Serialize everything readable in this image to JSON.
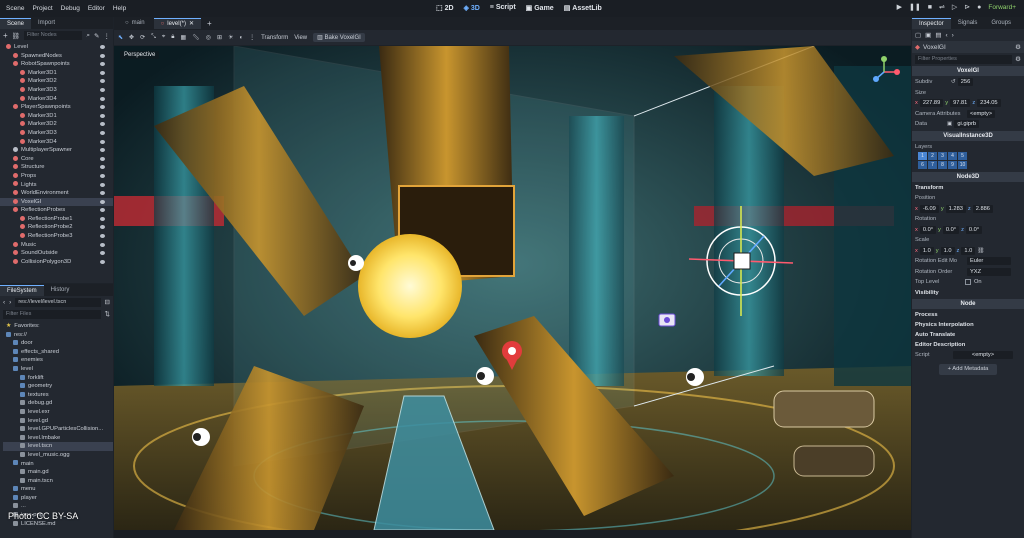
{
  "menu": [
    "Scene",
    "Project",
    "Debug",
    "Editor",
    "Help"
  ],
  "workspaces": [
    "2D",
    "3D",
    "Script",
    "Game",
    "AssetLib"
  ],
  "renderer": "Forward+",
  "scene_dock": {
    "tabs": [
      "Scene",
      "Import"
    ],
    "filter_placeholder": "Filter Nodes",
    "nodes": [
      {
        "label": "Level",
        "depth": 0,
        "color": "#e06b6b"
      },
      {
        "label": "SpawnedNodes",
        "depth": 1,
        "color": "#e06b6b"
      },
      {
        "label": "RobotSpawnpoints",
        "depth": 1,
        "color": "#e06b6b"
      },
      {
        "label": "Marker3D1",
        "depth": 2,
        "color": "#e06b6b"
      },
      {
        "label": "Marker3D2",
        "depth": 2,
        "color": "#e06b6b"
      },
      {
        "label": "Marker3D3",
        "depth": 2,
        "color": "#e06b6b"
      },
      {
        "label": "Marker3D4",
        "depth": 2,
        "color": "#e06b6b"
      },
      {
        "label": "PlayerSpawnpoints",
        "depth": 1,
        "color": "#e06b6b"
      },
      {
        "label": "Marker3D1",
        "depth": 2,
        "color": "#e06b6b"
      },
      {
        "label": "Marker3D2",
        "depth": 2,
        "color": "#e06b6b"
      },
      {
        "label": "Marker3D3",
        "depth": 2,
        "color": "#e06b6b"
      },
      {
        "label": "Marker3D4",
        "depth": 2,
        "color": "#e06b6b"
      },
      {
        "label": "MultiplayerSpawner",
        "depth": 1,
        "color": "#b9bec7"
      },
      {
        "label": "Core",
        "depth": 1,
        "color": "#e06b6b"
      },
      {
        "label": "Structure",
        "depth": 1,
        "color": "#e06b6b"
      },
      {
        "label": "Props",
        "depth": 1,
        "color": "#e06b6b"
      },
      {
        "label": "Lights",
        "depth": 1,
        "color": "#e06b6b"
      },
      {
        "label": "WorldEnvironment",
        "depth": 1,
        "color": "#e06b6b"
      },
      {
        "label": "VoxelGI",
        "depth": 1,
        "color": "#e06b6b",
        "selected": true
      },
      {
        "label": "ReflectionProbes",
        "depth": 1,
        "color": "#e06b6b"
      },
      {
        "label": "ReflectionProbe1",
        "depth": 2,
        "color": "#e06b6b"
      },
      {
        "label": "ReflectionProbe2",
        "depth": 2,
        "color": "#e06b6b"
      },
      {
        "label": "ReflectionProbe3",
        "depth": 2,
        "color": "#e06b6b"
      },
      {
        "label": "Music",
        "depth": 1,
        "color": "#e06b6b"
      },
      {
        "label": "SoundOutside",
        "depth": 1,
        "color": "#e06b6b"
      },
      {
        "label": "CollisionPolygon3D",
        "depth": 1,
        "color": "#e06b6b"
      }
    ]
  },
  "fs_dock": {
    "tabs": [
      "FileSystem",
      "History"
    ],
    "path": "res://level/level.tscn",
    "filter_placeholder": "Filter Files",
    "items": [
      {
        "label": "Favorites:",
        "depth": 0,
        "kind": "star"
      },
      {
        "label": "res://",
        "depth": 0,
        "kind": "folder"
      },
      {
        "label": "door",
        "depth": 1,
        "kind": "folder"
      },
      {
        "label": "effects_shared",
        "depth": 1,
        "kind": "folder"
      },
      {
        "label": "enemies",
        "depth": 1,
        "kind": "folder"
      },
      {
        "label": "level",
        "depth": 1,
        "kind": "folder"
      },
      {
        "label": "forklift",
        "depth": 2,
        "kind": "folder"
      },
      {
        "label": "geometry",
        "depth": 2,
        "kind": "folder"
      },
      {
        "label": "textures",
        "depth": 2,
        "kind": "folder"
      },
      {
        "label": "debug.gd",
        "depth": 2,
        "kind": "file"
      },
      {
        "label": "level.exr",
        "depth": 2,
        "kind": "file"
      },
      {
        "label": "level.gd",
        "depth": 2,
        "kind": "file"
      },
      {
        "label": "level.GPUParticlesCollision...",
        "depth": 2,
        "kind": "file"
      },
      {
        "label": "level.lmbake",
        "depth": 2,
        "kind": "file"
      },
      {
        "label": "level.tscn",
        "depth": 2,
        "kind": "file",
        "selected": true
      },
      {
        "label": "level_music.ogg",
        "depth": 2,
        "kind": "file"
      },
      {
        "label": "main",
        "depth": 1,
        "kind": "folder"
      },
      {
        "label": "main.gd",
        "depth": 2,
        "kind": "file"
      },
      {
        "label": "main.tscn",
        "depth": 2,
        "kind": "file"
      },
      {
        "label": "menu",
        "depth": 1,
        "kind": "folder"
      },
      {
        "label": "player",
        "depth": 1,
        "kind": "folder"
      },
      {
        "label": "...",
        "depth": 1,
        "kind": "file"
      },
      {
        "label": "icon.png",
        "depth": 1,
        "kind": "file"
      },
      {
        "label": "LICENSE.md",
        "depth": 1,
        "kind": "file"
      }
    ]
  },
  "editor_tabs": [
    "main",
    "level(*)"
  ],
  "viewport_toolbar": {
    "transform": "Transform",
    "view": "View",
    "bake": "Bake VoxelGI"
  },
  "viewport_label": "Perspective",
  "watermark": "Photo: CC BY-SA",
  "inspector": {
    "tabs": [
      "Inspector",
      "Signals",
      "Groups"
    ],
    "node": "VoxelGI",
    "filter_placeholder": "Filter Properties",
    "class_header": "VoxelGI",
    "subdiv_label": "Subdiv",
    "subdiv": "256",
    "size_label": "Size",
    "size_x": "227.89",
    "size_y": "97.81",
    "size_z": "234.05",
    "camattr_label": "Camera Attributes",
    "camattr": "<empty>",
    "data_label": "Data",
    "data": "gi.giprb",
    "vi_header": "VisualInstance3D",
    "layers_label": "Layers",
    "layer_numbers": [
      "1",
      "2",
      "3",
      "4",
      "5",
      "6",
      "7",
      "8",
      "9",
      "10"
    ],
    "node3d_header": "Node3D",
    "transform": "Transform",
    "position_label": "Position",
    "pos_x": "-6.09",
    "pos_y": "1.283",
    "pos_z": "2.886",
    "rotation_label": "Rotation",
    "rot_x": "0.0°",
    "rot_y": "0.0°",
    "rot_z": "0.0°",
    "scale_label": "Scale",
    "scale_x": "1.0",
    "scale_y": "1.0",
    "scale_z": "1.0",
    "rem_label": "Rotation Edit Mo",
    "rem": "Euler",
    "ro_label": "Rotation Order",
    "ro": "YXZ",
    "tl_label": "Top Level",
    "tl": "On",
    "visibility": "Visibility",
    "node_header": "Node",
    "groups": [
      "Process",
      "Physics Interpolation",
      "Auto Translate",
      "Editor Description"
    ],
    "script_label": "Script",
    "script": "<empty>",
    "add_metadata": "Add Metadata"
  }
}
